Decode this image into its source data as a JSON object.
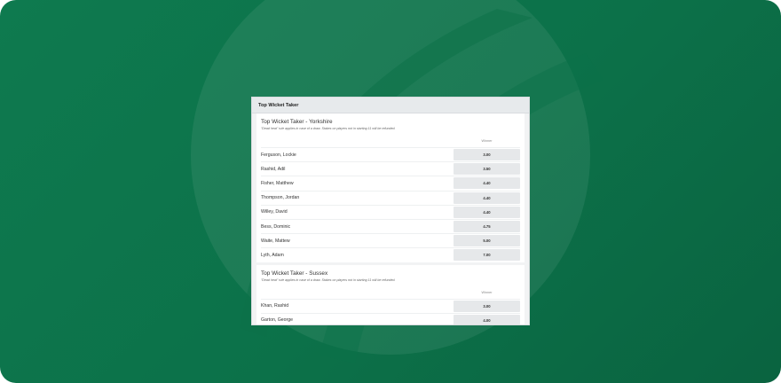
{
  "panel": {
    "title": "Top Wicket Taker"
  },
  "markets": [
    {
      "title": "Top Wicket Taker - Yorkshire",
      "note": "\"Dead heat\" rule applies in case of a draw. Stakes on players not in starting 11 will be refunded.",
      "column_header": "Winner",
      "rows": [
        {
          "player": "Ferguson, Lockie",
          "odds": "3.00"
        },
        {
          "player": "Rashid, Adil",
          "odds": "3.50"
        },
        {
          "player": "Fisher, Matthew",
          "odds": "4.40"
        },
        {
          "player": "Thompson, Jordan",
          "odds": "4.40"
        },
        {
          "player": "Willey, David",
          "odds": "4.40"
        },
        {
          "player": "Bess, Dominic",
          "odds": "4.75"
        },
        {
          "player": "Waite, Mattew",
          "odds": "5.00"
        },
        {
          "player": "Lyth, Adam",
          "odds": "7.00"
        }
      ]
    },
    {
      "title": "Top Wicket Taker - Sussex",
      "note": "\"Dead heat\" rule applies in case of a draw. Stakes on players not in starting 11 will be refunded.",
      "column_header": "Winner",
      "rows": [
        {
          "player": "Khan, Rashid",
          "odds": "3.00"
        },
        {
          "player": "Garton, George",
          "odds": "4.00"
        }
      ]
    }
  ],
  "colors": {
    "background": "#0c7149",
    "panel": "#f2f3f4",
    "odds_button": "#e6e8ea"
  }
}
